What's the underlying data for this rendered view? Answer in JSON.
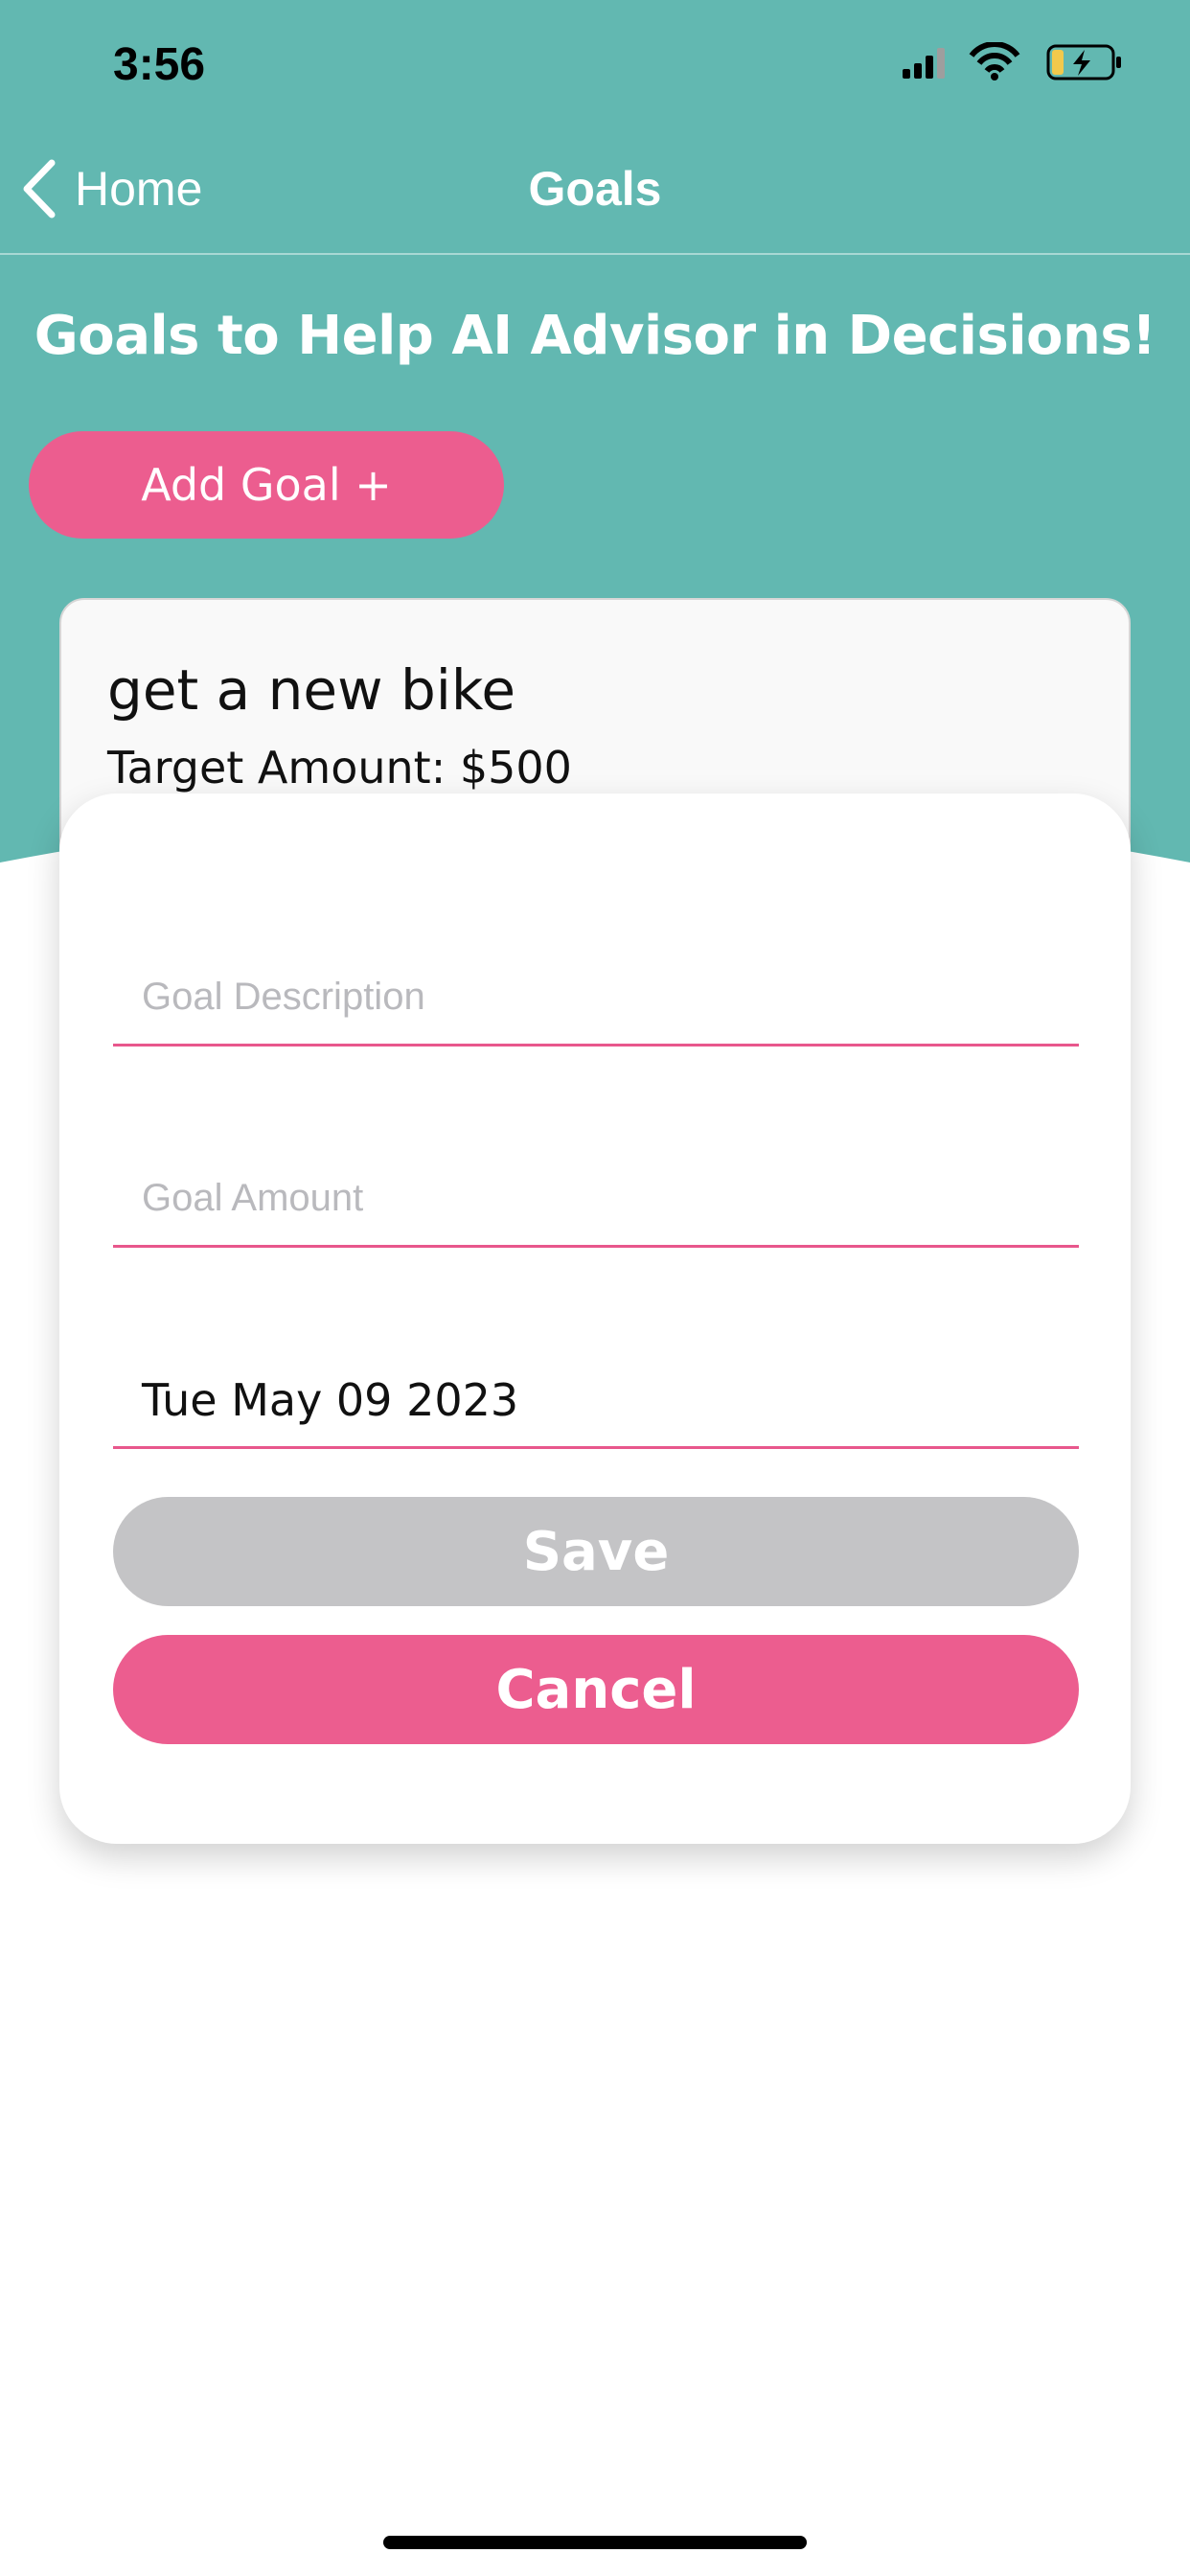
{
  "colors": {
    "teal": "#62b8b1",
    "pink": "#ec5d8f",
    "save_disabled": "#c4c4c6"
  },
  "status_bar": {
    "time": "3:56",
    "icons": [
      "cellular-signal-icon",
      "wifi-icon",
      "battery-charging-icon"
    ]
  },
  "nav": {
    "back_label": "Home",
    "title": "Goals"
  },
  "header": {
    "heading": "Goals to Help AI Advisor in Decisions!",
    "add_goal_label": "Add Goal +"
  },
  "goal_card": {
    "description": "get a new bike",
    "target": "Target Amount: $500"
  },
  "modal": {
    "description": {
      "value": "",
      "placeholder": "Goal Description"
    },
    "amount": {
      "value": "",
      "placeholder": "Goal Amount"
    },
    "date": "Tue May 09 2023",
    "save_label": "Save",
    "cancel_label": "Cancel"
  }
}
